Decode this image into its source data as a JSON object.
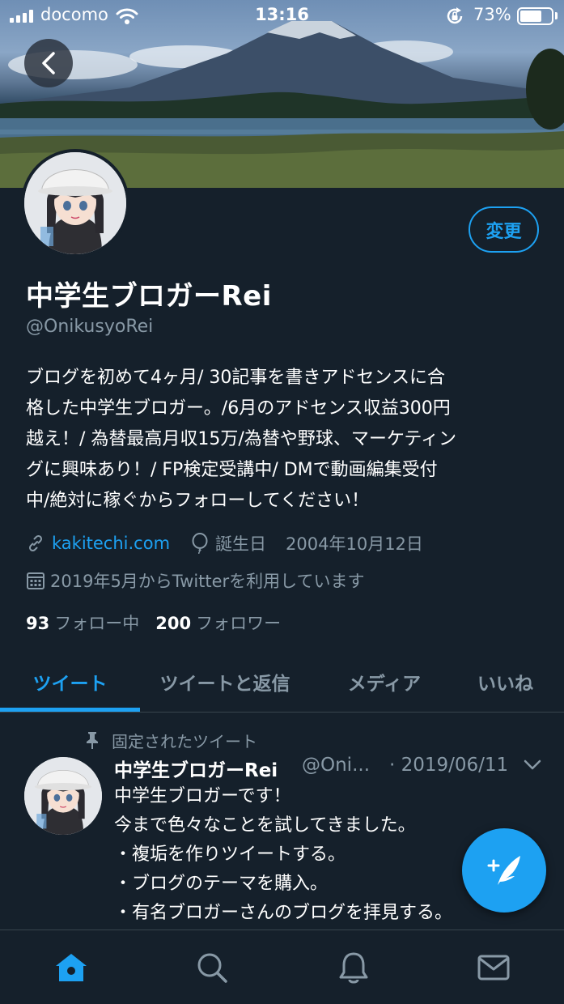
{
  "status_bar": {
    "carrier": "docomo",
    "time": "13:16",
    "battery_percent": "73%",
    "battery_level": 0.73
  },
  "header": {
    "back_icon": "chevron-left-icon",
    "banner_description": "mountain-lake-photo"
  },
  "profile": {
    "edit_button": "変更",
    "display_name": "中学生ブロガーRei",
    "handle": "@OnikusyoRei",
    "bio": "ブログを初めて4ヶ月/ 30記事を書きアドセンスに合\n格した中学生ブロガー。/6月のアドセンス収益300円\n越え！/ 為替最高月収15万/為替や野球、マーケティン\nグに興味あり！/ FP検定受講中/ DMで動画編集受付\n中/絶対に稼ぐからフォローしてください！",
    "website": "kakitechi.com",
    "birthday_label": "誕生日",
    "birthday_date": "2004年10月12日",
    "joined": "2019年5月からTwitterを利用しています",
    "following_count": "93",
    "following_label": "フォロー中",
    "followers_count": "200",
    "followers_label": "フォロワー"
  },
  "tabs": [
    {
      "label": "ツイート",
      "active": true
    },
    {
      "label": "ツイートと返信",
      "active": false
    },
    {
      "label": "メディア",
      "active": false
    },
    {
      "label": "いいね",
      "active": false
    }
  ],
  "pinned_tweet": {
    "pinned_label": "固定されたツイート",
    "author_name": "中学生ブロガーRei",
    "author_handle": "@Oni...",
    "date": "· 2019/06/11",
    "text": "中学生ブロガーです！\n今まで色々なことを試してきました。\n・複垢を作りツイートする。\n・ブログのテーマを購入。\n・有名ブロガーさんのブログを拝見する。"
  },
  "bottom_nav": [
    {
      "icon": "home-icon",
      "active": true
    },
    {
      "icon": "search-icon",
      "active": false
    },
    {
      "icon": "bell-icon",
      "active": false
    },
    {
      "icon": "mail-icon",
      "active": false
    }
  ],
  "colors": {
    "background": "#15202b",
    "accent": "#1da1f2",
    "secondary_text": "#8899a6",
    "divider": "#38444d"
  }
}
